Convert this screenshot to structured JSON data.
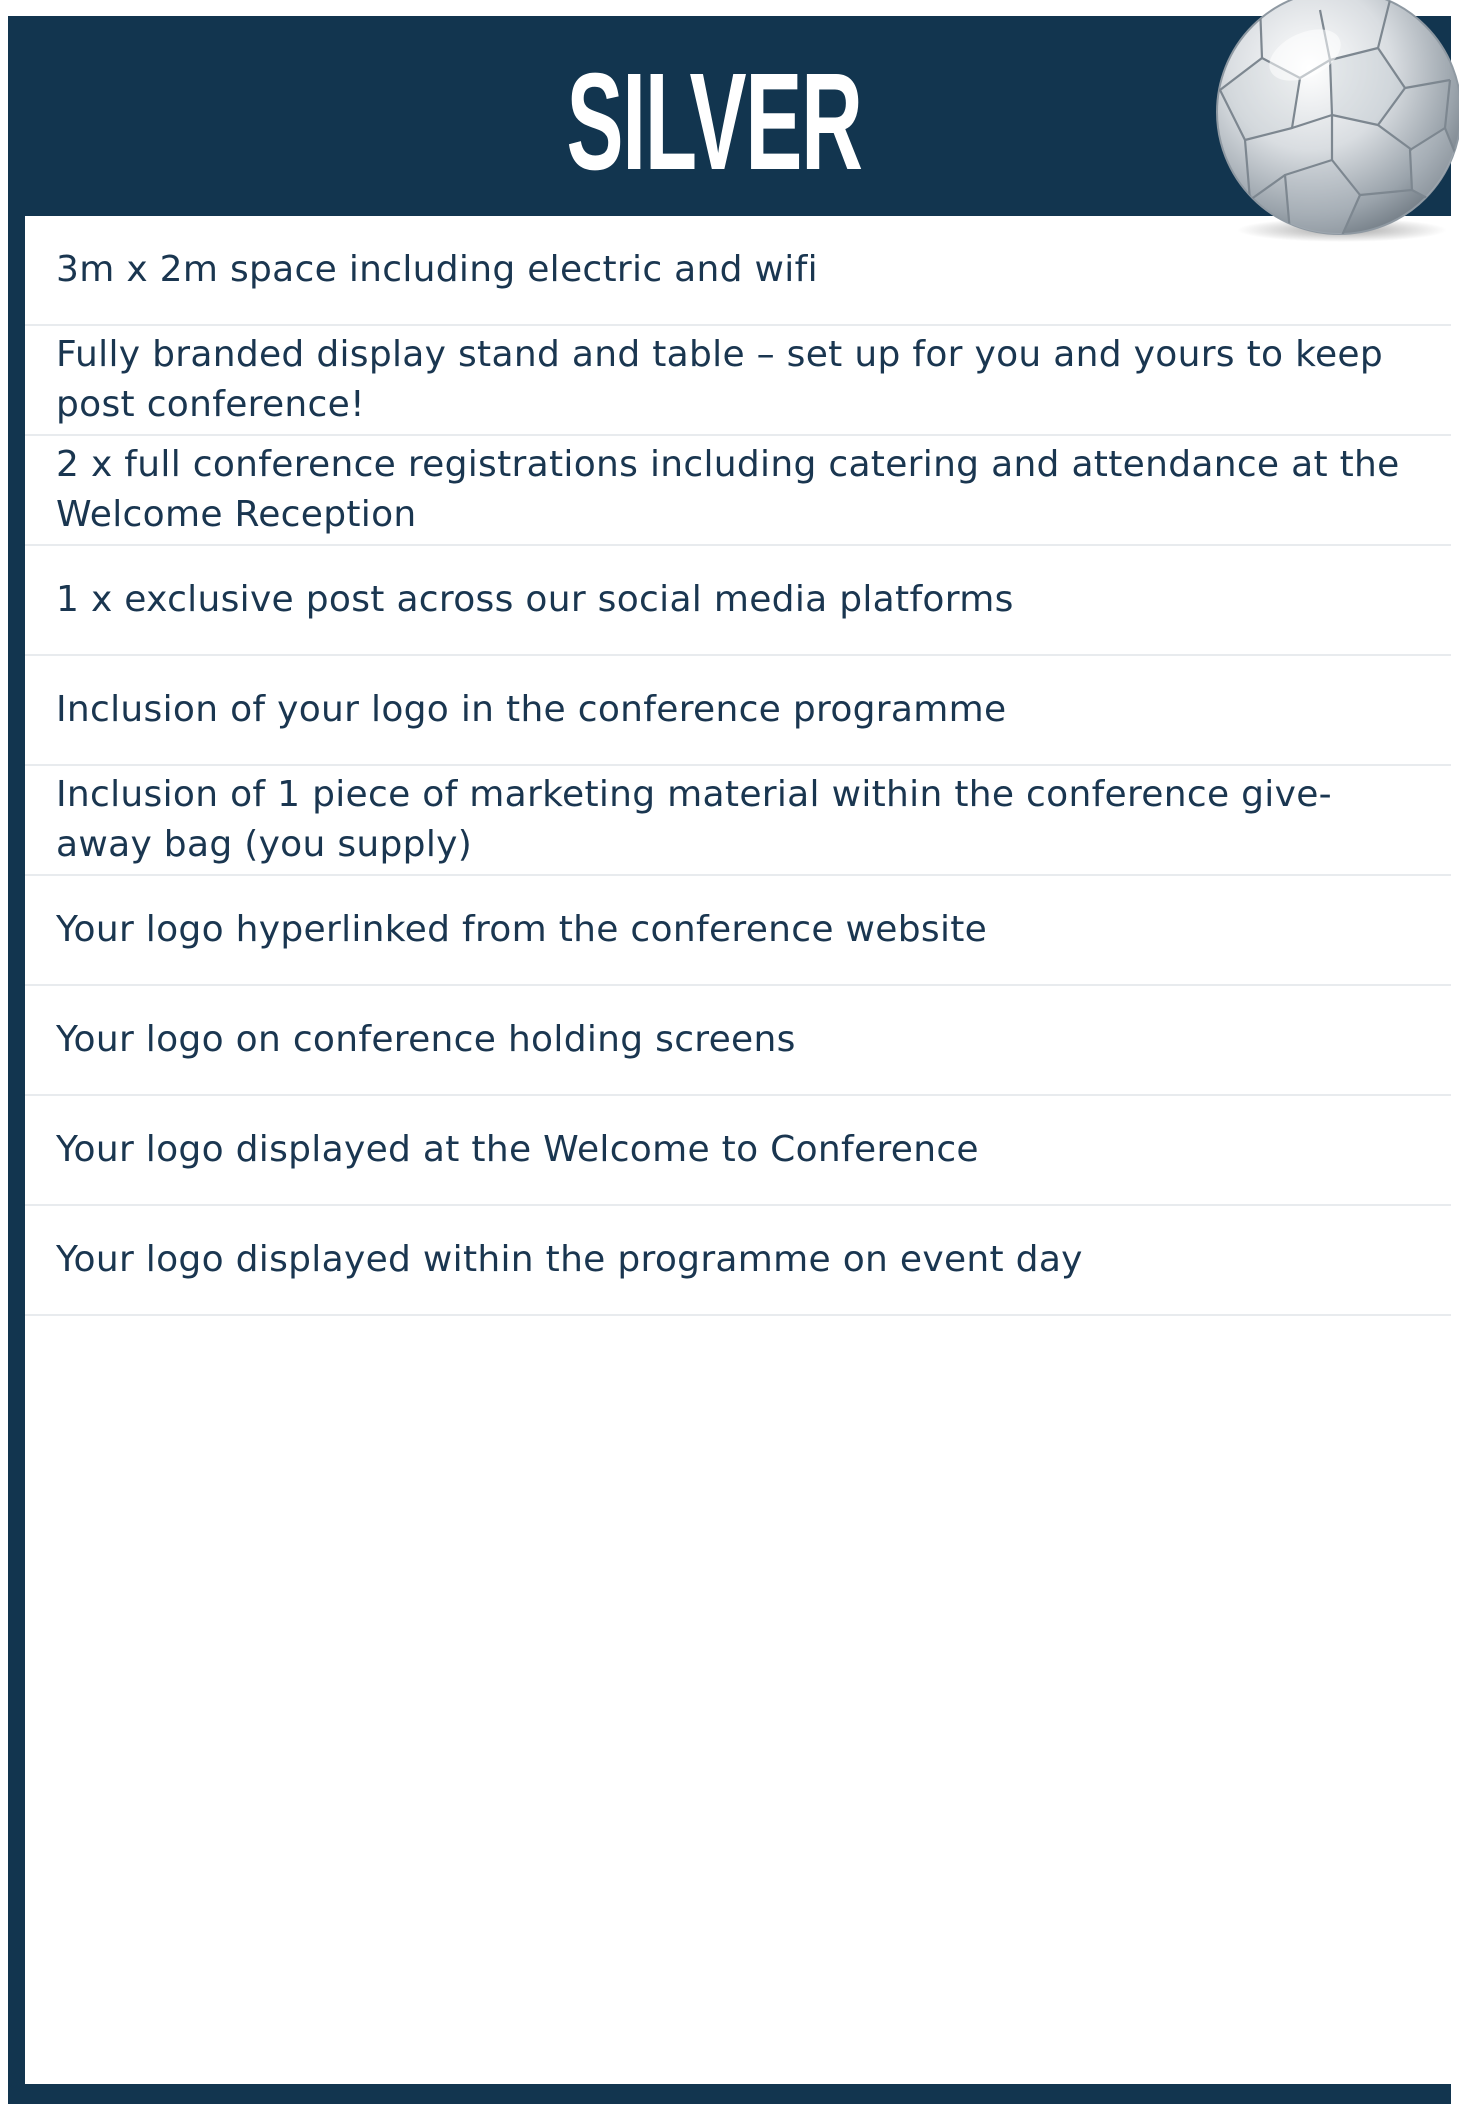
{
  "header": {
    "title": "SILVER"
  },
  "benefits": [
    "3m x 2m space including electric and wifi",
    "Fully branded display stand and table – set up for you and yours to keep post conference!",
    "2 x full conference registrations including catering and attendance at the Welcome Reception",
    "1 x exclusive post across our social media platforms",
    "Inclusion of your logo in the conference programme",
    "Inclusion of 1 piece of marketing material within the conference give-away bag (you supply)",
    "Your logo hyperlinked from the conference website",
    "Your logo on conference holding screens",
    "Your logo displayed at the Welcome to Conference",
    "Your logo displayed within the programme on event day"
  ],
  "colors": {
    "navy": "#12354f",
    "text": "#1a3650",
    "divider": "#e8ebee"
  },
  "icons": {
    "ball": "silver-football-icon"
  }
}
